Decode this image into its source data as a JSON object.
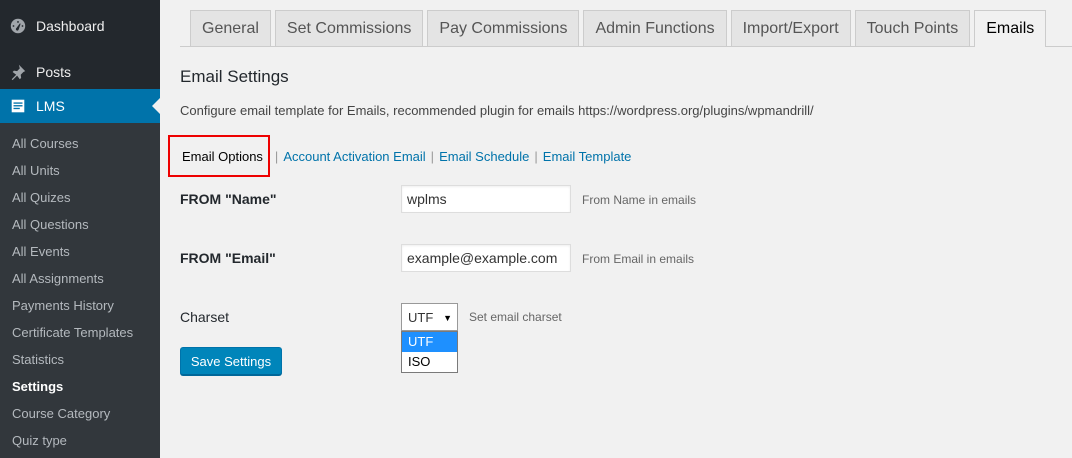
{
  "sidebar": {
    "top_items": [
      {
        "label": "Dashboard",
        "icon": "dashboard-icon"
      },
      {
        "label": "Posts",
        "icon": "pushpin-icon"
      },
      {
        "label": "LMS",
        "icon": "lms-icon"
      }
    ],
    "submenu": [
      "All Courses",
      "All Units",
      "All Quizes",
      "All Questions",
      "All Events",
      "All Assignments",
      "Payments History",
      "Certificate Templates",
      "Statistics",
      "Settings",
      "Course Category",
      "Quiz type"
    ],
    "current_submenu": "Settings"
  },
  "tabs": [
    "General",
    "Set Commissions",
    "Pay Commissions",
    "Admin Functions",
    "Import/Export",
    "Touch Points",
    "Emails"
  ],
  "active_tab": "Emails",
  "main": {
    "title": "Email Settings",
    "description": "Configure email template for Emails, recommended plugin for emails https://wordpress.org/plugins/wpmandrill/",
    "subnav": {
      "current": "Email Options",
      "links": [
        "Account Activation Email",
        "Email Schedule",
        "Email Template"
      ],
      "separator": "|"
    },
    "fields": {
      "from_name": {
        "label": "FROM \"Name\"",
        "value": "wplms",
        "hint": "From Name in emails"
      },
      "from_email": {
        "label": "FROM \"Email\"",
        "value": "example@example.com",
        "hint": "From Email in emails"
      },
      "charset": {
        "label": "Charset",
        "value": "UTF",
        "hint": "Set email charset",
        "options": [
          "UTF",
          "ISO"
        ],
        "highlighted": "UTF"
      }
    },
    "save_label": "Save Settings"
  },
  "colors": {
    "sidebar_bg": "#23282d",
    "submenu_bg": "#32373c",
    "accent": "#0073aa",
    "button": "#0085ba",
    "highlight_box": "#ee0000"
  }
}
